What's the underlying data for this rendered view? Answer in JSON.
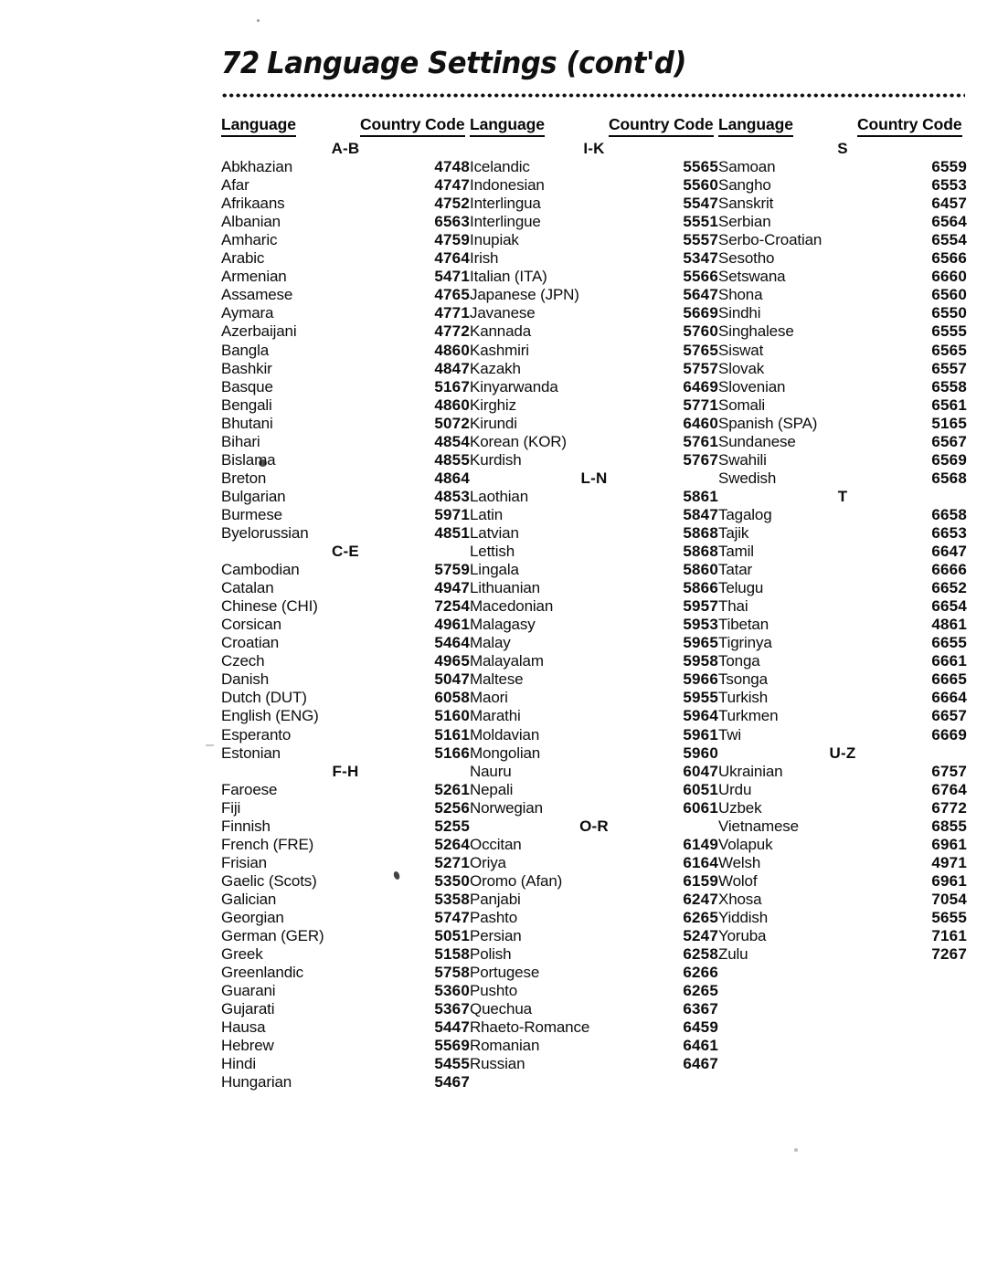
{
  "document": {
    "page_number": "72",
    "title": "Language Settings (cont'd)"
  },
  "table": {
    "headers": {
      "language": "Language",
      "country_code": "Country Code"
    },
    "column_groups": [
      {
        "id": "col-1",
        "sections": [
          {
            "label": "A-B",
            "rows": [
              {
                "language": "Abkhazian",
                "code": "4748"
              },
              {
                "language": "Afar",
                "code": "4747"
              },
              {
                "language": "Afrikaans",
                "code": "4752"
              },
              {
                "language": "Albanian",
                "code": "6563"
              },
              {
                "language": "Amharic",
                "code": "4759"
              },
              {
                "language": "Arabic",
                "code": "4764"
              },
              {
                "language": "Armenian",
                "code": "5471"
              },
              {
                "language": "Assamese",
                "code": "4765"
              },
              {
                "language": "Aymara",
                "code": "4771"
              },
              {
                "language": "Azerbaijani",
                "code": "4772"
              },
              {
                "language": "Bangla",
                "code": "4860"
              },
              {
                "language": "Bashkir",
                "code": "4847"
              },
              {
                "language": "Basque",
                "code": "5167"
              },
              {
                "language": "Bengali",
                "code": "4860"
              },
              {
                "language": "Bhutani",
                "code": "5072"
              },
              {
                "language": "Bihari",
                "code": "4854"
              },
              {
                "language": "Bislama",
                "code": "4855"
              },
              {
                "language": "Breton",
                "code": "4864"
              },
              {
                "language": "Bulgarian",
                "code": "4853"
              },
              {
                "language": "Burmese",
                "code": "5971"
              },
              {
                "language": "Byelorussian",
                "code": "4851"
              }
            ]
          },
          {
            "label": "C-E",
            "rows": [
              {
                "language": "Cambodian",
                "code": "5759"
              },
              {
                "language": "Catalan",
                "code": "4947"
              },
              {
                "language": "Chinese (CHI)",
                "code": "7254"
              },
              {
                "language": "Corsican",
                "code": "4961"
              },
              {
                "language": "Croatian",
                "code": "5464"
              },
              {
                "language": "Czech",
                "code": "4965"
              },
              {
                "language": "Danish",
                "code": "5047"
              },
              {
                "language": "Dutch (DUT)",
                "code": "6058"
              },
              {
                "language": "English (ENG)",
                "code": "5160"
              },
              {
                "language": "Esperanto",
                "code": "5161"
              },
              {
                "language": "Estonian",
                "code": "5166"
              }
            ]
          },
          {
            "label": "F-H",
            "rows": [
              {
                "language": "Faroese",
                "code": "5261"
              },
              {
                "language": "Fiji",
                "code": "5256"
              },
              {
                "language": "Finnish",
                "code": "5255"
              },
              {
                "language": "French (FRE)",
                "code": "5264"
              },
              {
                "language": "Frisian",
                "code": "5271"
              },
              {
                "language": "Gaelic (Scots)",
                "code": "5350"
              },
              {
                "language": "Galician",
                "code": "5358"
              },
              {
                "language": "Georgian",
                "code": "5747"
              },
              {
                "language": "German (GER)",
                "code": "5051"
              },
              {
                "language": "Greek",
                "code": "5158"
              },
              {
                "language": "Greenlandic",
                "code": "5758"
              },
              {
                "language": "Guarani",
                "code": "5360"
              },
              {
                "language": "Gujarati",
                "code": "5367"
              },
              {
                "language": "Hausa",
                "code": "5447"
              },
              {
                "language": "Hebrew",
                "code": "5569"
              },
              {
                "language": "Hindi",
                "code": "5455"
              },
              {
                "language": "Hungarian",
                "code": "5467"
              }
            ]
          }
        ]
      },
      {
        "id": "col-2",
        "sections": [
          {
            "label": "I-K",
            "rows": [
              {
                "language": "Icelandic",
                "code": "5565"
              },
              {
                "language": "Indonesian",
                "code": "5560"
              },
              {
                "language": "Interlingua",
                "code": "5547"
              },
              {
                "language": "Interlingue",
                "code": "5551"
              },
              {
                "language": "Inupiak",
                "code": "5557"
              },
              {
                "language": "Irish",
                "code": "5347"
              },
              {
                "language": "Italian (ITA)",
                "code": "5566"
              },
              {
                "language": "Japanese (JPN)",
                "code": "5647"
              },
              {
                "language": "Javanese",
                "code": "5669"
              },
              {
                "language": "Kannada",
                "code": "5760"
              },
              {
                "language": "Kashmiri",
                "code": "5765"
              },
              {
                "language": "Kazakh",
                "code": "5757"
              },
              {
                "language": "Kinyarwanda",
                "code": "6469"
              },
              {
                "language": "Kirghiz",
                "code": "5771"
              },
              {
                "language": "Kirundi",
                "code": "6460"
              },
              {
                "language": "Korean (KOR)",
                "code": "5761"
              },
              {
                "language": "Kurdish",
                "code": "5767"
              }
            ]
          },
          {
            "label": "L-N",
            "rows": [
              {
                "language": "Laothian",
                "code": "5861"
              },
              {
                "language": "Latin",
                "code": "5847"
              },
              {
                "language": "Latvian",
                "code": "5868"
              },
              {
                "language": "Lettish",
                "code": "5868"
              },
              {
                "language": "Lingala",
                "code": "5860"
              },
              {
                "language": "Lithuanian",
                "code": "5866"
              },
              {
                "language": "Macedonian",
                "code": "5957"
              },
              {
                "language": "Malagasy",
                "code": "5953"
              },
              {
                "language": "Malay",
                "code": "5965"
              },
              {
                "language": "Malayalam",
                "code": "5958"
              },
              {
                "language": "Maltese",
                "code": "5966"
              },
              {
                "language": "Maori",
                "code": "5955"
              },
              {
                "language": "Marathi",
                "code": "5964"
              },
              {
                "language": "Moldavian",
                "code": "5961"
              },
              {
                "language": "Mongolian",
                "code": "5960"
              },
              {
                "language": "Nauru",
                "code": "6047"
              },
              {
                "language": "Nepali",
                "code": "6051"
              },
              {
                "language": "Norwegian",
                "code": "6061"
              }
            ]
          },
          {
            "label": "O-R",
            "rows": [
              {
                "language": "Occitan",
                "code": "6149"
              },
              {
                "language": "Oriya",
                "code": "6164"
              },
              {
                "language": "Oromo (Afan)",
                "code": "6159"
              },
              {
                "language": "Panjabi",
                "code": "6247"
              },
              {
                "language": "Pashto",
                "code": "6265"
              },
              {
                "language": "Persian",
                "code": "5247"
              },
              {
                "language": "Polish",
                "code": "6258"
              },
              {
                "language": "Portugese",
                "code": "6266"
              },
              {
                "language": "Pushto",
                "code": "6265"
              },
              {
                "language": "Quechua",
                "code": "6367"
              },
              {
                "language": "Rhaeto-Romance",
                "code": "6459"
              },
              {
                "language": "Romanian",
                "code": "6461"
              },
              {
                "language": "Russian",
                "code": "6467"
              }
            ]
          }
        ]
      },
      {
        "id": "col-3",
        "sections": [
          {
            "label": "S",
            "rows": [
              {
                "language": "Samoan",
                "code": "6559"
              },
              {
                "language": "Sangho",
                "code": "6553"
              },
              {
                "language": "Sanskrit",
                "code": "6457"
              },
              {
                "language": "Serbian",
                "code": "6564"
              },
              {
                "language": "Serbo-Croatian",
                "code": "6554"
              },
              {
                "language": "Sesotho",
                "code": "6566"
              },
              {
                "language": "Setswana",
                "code": "6660"
              },
              {
                "language": "Shona",
                "code": "6560"
              },
              {
                "language": "Sindhi",
                "code": "6550"
              },
              {
                "language": "Singhalese",
                "code": "6555"
              },
              {
                "language": "Siswat",
                "code": "6565"
              },
              {
                "language": "Slovak",
                "code": "6557"
              },
              {
                "language": "Slovenian",
                "code": "6558"
              },
              {
                "language": "Somali",
                "code": "6561"
              },
              {
                "language": "Spanish (SPA)",
                "code": "5165"
              },
              {
                "language": "Sundanese",
                "code": "6567"
              },
              {
                "language": "Swahili",
                "code": "6569"
              },
              {
                "language": "Swedish",
                "code": "6568"
              }
            ]
          },
          {
            "label": "T",
            "rows": [
              {
                "language": "Tagalog",
                "code": "6658"
              },
              {
                "language": "Tajik",
                "code": "6653"
              },
              {
                "language": "Tamil",
                "code": "6647"
              },
              {
                "language": "Tatar",
                "code": "6666"
              },
              {
                "language": "Telugu",
                "code": "6652"
              },
              {
                "language": "Thai",
                "code": "6654"
              },
              {
                "language": "Tibetan",
                "code": "4861"
              },
              {
                "language": "Tigrinya",
                "code": "6655"
              },
              {
                "language": "Tonga",
                "code": "6661"
              },
              {
                "language": "Tsonga",
                "code": "6665"
              },
              {
                "language": "Turkish",
                "code": "6664"
              },
              {
                "language": "Turkmen",
                "code": "6657"
              },
              {
                "language": "Twi",
                "code": "6669"
              }
            ]
          },
          {
            "label": "U-Z",
            "rows": [
              {
                "language": "Ukrainian",
                "code": "6757"
              },
              {
                "language": "Urdu",
                "code": "6764"
              },
              {
                "language": "Uzbek",
                "code": "6772"
              },
              {
                "language": "Vietnamese",
                "code": "6855"
              },
              {
                "language": "Volapuk",
                "code": "6961"
              },
              {
                "language": "Welsh",
                "code": "4971"
              },
              {
                "language": "Wolof",
                "code": "6961"
              },
              {
                "language": "Xhosa",
                "code": "7054"
              },
              {
                "language": "Yiddish",
                "code": "5655"
              },
              {
                "language": "Yoruba",
                "code": "7161"
              },
              {
                "language": "Zulu",
                "code": "7267"
              }
            ]
          }
        ]
      }
    ]
  }
}
